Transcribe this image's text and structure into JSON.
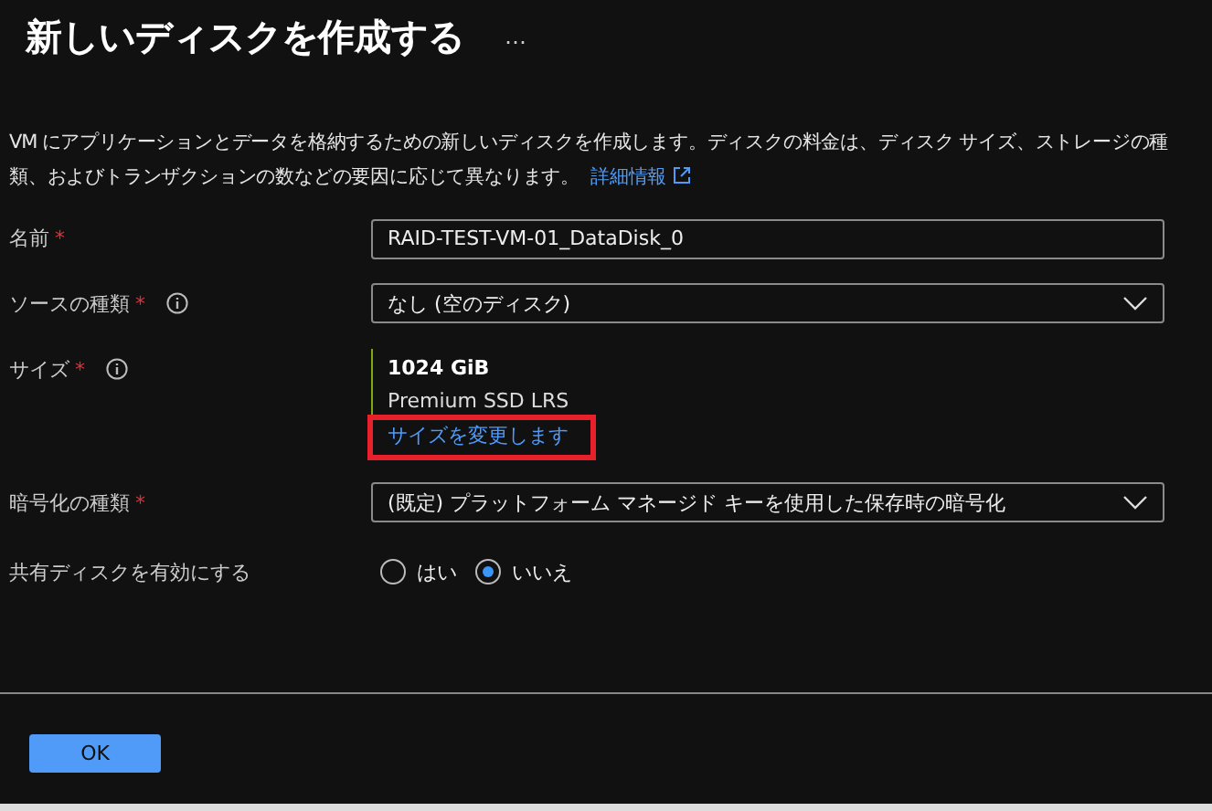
{
  "title": "新しいディスクを作成する",
  "more_menu": "…",
  "description": {
    "text": "VM にアプリケーションとデータを格納するための新しいディスクを作成します。ディスクの料金は、ディスク サイズ、ストレージの種類、およびトランザクションの数などの要因に応じて異なります。",
    "link": "詳細情報"
  },
  "fields": [
    {
      "kind": "text",
      "label": "名前",
      "required_mark": "*",
      "info": false,
      "value": "RAID-TEST-VM-01_DataDisk_0"
    },
    {
      "kind": "dropdown",
      "label": "ソースの種類",
      "required_mark": "*",
      "info": true,
      "value": "なし (空のディスク)"
    },
    {
      "kind": "size",
      "label": "サイズ",
      "required_mark": "*",
      "info": true,
      "size": "1024 GiB",
      "tier": "Premium SSD LRS",
      "link": "サイズを変更します",
      "highlighted": true
    },
    {
      "kind": "dropdown",
      "label": "暗号化の種類",
      "required_mark": "*",
      "info": false,
      "value": "(既定) プラットフォーム マネージド キーを使用した保存時の暗号化"
    },
    {
      "kind": "radio",
      "label": "共有ディスクを有効にする",
      "info": false,
      "options": [
        {
          "label": "はい",
          "selected": false
        },
        {
          "label": "いいえ",
          "selected": true
        }
      ]
    }
  ],
  "buttons": [
    "OK"
  ]
}
